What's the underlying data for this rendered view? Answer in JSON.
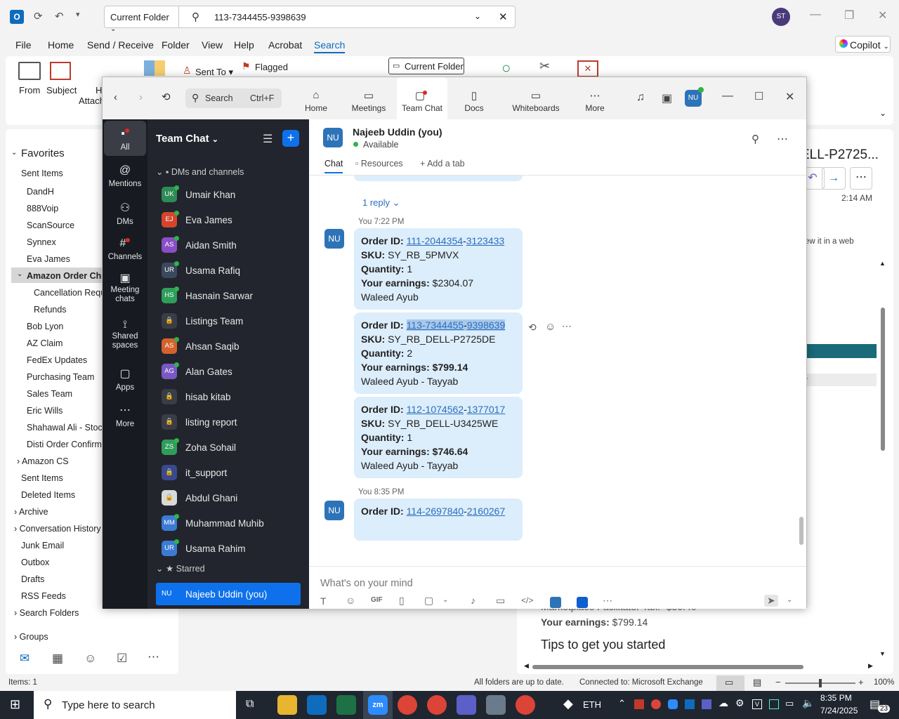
{
  "outlook": {
    "scope": "Current Folder",
    "search_query": "113-7344455-9398639",
    "user_initials": "ST",
    "menu": [
      "File",
      "Home",
      "Send / Receive",
      "Folder",
      "View",
      "Help",
      "Acrobat",
      "Search"
    ],
    "copilot": "Copilot",
    "ribbon": {
      "from": "From",
      "subject": "Subject",
      "has_attach_1": "H",
      "has_attach_2": "Attach",
      "sent_to": "Sent To",
      "flagged": "Flagged",
      "current_folder": "Current Folder"
    },
    "favorites_title": "Favorites",
    "folders": [
      "Sent Items",
      "DandH",
      "888Voip",
      "ScanSource",
      "Synnex",
      "Eva James",
      "Amazon Order Cho",
      "Cancellation Requ",
      "Refunds",
      "Bob Lyon",
      "AZ Claim",
      "FedEx Updates",
      "Purchasing Team",
      "Sales Team",
      "Eric Wills",
      "Shahawal Ali - Stock",
      "Disti Order Confirma",
      "Amazon CS",
      "Sent Items",
      "Deleted Items",
      "Archive",
      "Conversation History",
      "Junk Email",
      "Outbox",
      "Drafts",
      "RSS Feeds",
      "Search Folders",
      "Groups"
    ],
    "reading": {
      "subject_tail": "ELL-P2725...",
      "time": "2:14 AM",
      "web_note": "ew it in a web",
      "fragment_r": "r",
      "facilitator": "Marketplace Facilitator Tax: -$56.40",
      "earnings_label": "Your earnings:",
      "earnings_value": "$799.14",
      "tips": "Tips to get you started"
    },
    "status": {
      "items": "Items: 1",
      "sync": "All folders are up to date.",
      "connection": "Connected to: Microsoft Exchange",
      "zoom": "100%"
    }
  },
  "taskbar": {
    "search_placeholder": "Type here to search",
    "eth": "ETH",
    "time": "8:35 PM",
    "date": "7/24/2025",
    "notif_count": "23"
  },
  "zoom": {
    "search_label": "Search",
    "search_shortcut": "Ctrl+F",
    "tabs": [
      "Home",
      "Meetings",
      "Team Chat",
      "Docs",
      "Whiteboards",
      "More"
    ],
    "avatar": "NU",
    "rail": [
      "All",
      "Mentions",
      "DMs",
      "Channels",
      "Meeting chats",
      "Shared spaces",
      "Apps",
      "More"
    ],
    "list_title": "Team Chat",
    "section_dms": "DMs and channels",
    "section_starred": "Starred",
    "chats": [
      {
        "initials": "UK",
        "name": "Umair Khan",
        "color": "#2e8b57"
      },
      {
        "initials": "EJ",
        "name": "Eva James",
        "color": "#d4452c"
      },
      {
        "initials": "AS",
        "name": "Aidan Smith",
        "color": "#8a4fc6"
      },
      {
        "initials": "UR",
        "name": "Usama Rafiq",
        "color": "#3a4a5c"
      },
      {
        "initials": "HS",
        "name": "Hasnain Sarwar",
        "color": "#2f9e5a"
      },
      {
        "initials": "",
        "name": "Listings Team",
        "color": "#3a3d45"
      },
      {
        "initials": "AS",
        "name": "Ahsan Saqib",
        "color": "#d4622c"
      },
      {
        "initials": "AG",
        "name": "Alan Gates",
        "color": "#7a58c4"
      },
      {
        "initials": "",
        "name": "hisab kitab",
        "color": "#3a3d45"
      },
      {
        "initials": "",
        "name": "listing report",
        "color": "#3a3d45"
      },
      {
        "initials": "ZS",
        "name": "Zoha Sohail",
        "color": "#2f9e5a"
      },
      {
        "initials": "",
        "name": "it_support",
        "color": "#3a4a8c"
      },
      {
        "initials": "",
        "name": "Abdul Ghani",
        "color": "#d9d9d9"
      },
      {
        "initials": "MM",
        "name": "Muhammad Muhib",
        "color": "#3b7bd4"
      },
      {
        "initials": "UR",
        "name": "Usama Rahim",
        "color": "#3b7bd4"
      }
    ],
    "starred_self": {
      "initials": "NU",
      "name": "Najeeb Uddin (you)"
    },
    "header": {
      "initials": "NU",
      "name": "Najeeb Uddin (you)",
      "status": "Available"
    },
    "subtabs": [
      "Chat",
      "Resources",
      "Add a tab"
    ],
    "reply": "1 reply",
    "time1": "You 7:22 PM",
    "time2": "You 8:35 PM",
    "labels": {
      "order": "Order ID:",
      "sku": "SKU:",
      "qty": "Quantity:",
      "earn": "Your earnings:"
    },
    "messages": [
      {
        "order_a": "111-2044354",
        "order_b": "3123433",
        "sku": "SY_RB_5PMVX",
        "qty": "1",
        "earnings": "$2304.07",
        "by": "Waleed Ayub"
      },
      {
        "order_a": "113-7344455",
        "order_b": "9398639",
        "sku": "SY_RB_DELL-P2725DE",
        "qty": "2",
        "earnings": "$799.14",
        "by": "Waleed Ayub - Tayyab"
      },
      {
        "order_a": "112-1074562",
        "order_b": "1377017",
        "sku": "SY_RB_DELL-U3425WE",
        "qty": "1",
        "earnings": "$746.64",
        "by": "Waleed Ayub - Tayyab"
      },
      {
        "order_a": "114-2697840",
        "order_b": "2160267"
      }
    ],
    "compose_placeholder": "What's on your mind"
  }
}
